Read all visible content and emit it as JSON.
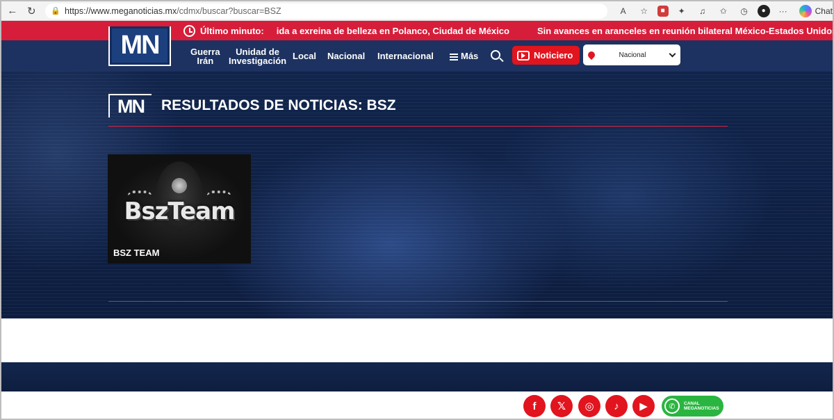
{
  "browser": {
    "url_host": "https://www.meganoticias.mx",
    "url_path": "/cdmx/buscar?buscar=BSZ",
    "chat_label": "Chat"
  },
  "breaking": {
    "label": "Último minuto:",
    "items": [
      "ida a exreina de belleza en Polanco, Ciudad de México",
      "Sin avances en aranceles en reunión bilateral México-Estados Unidos"
    ]
  },
  "header": {
    "logo_text": "MN",
    "nav": [
      {
        "line1": "Guerra",
        "line2": "Irán"
      },
      {
        "line1": "Unidad de",
        "line2": "Investigación"
      },
      {
        "label": "Local"
      },
      {
        "label": "Nacional"
      },
      {
        "label": "Internacional"
      },
      {
        "label": "Más"
      }
    ],
    "noticiero_label": "Noticiero",
    "region_value": "Nacional"
  },
  "results": {
    "badge": "MN",
    "title": "RESULTADOS DE NOTICIAS: BSZ",
    "cards": [
      {
        "title": "BSZ TEAM",
        "image_text": "BszTeam"
      }
    ]
  },
  "footer": {
    "social": [
      "facebook-icon",
      "x-icon",
      "instagram-icon",
      "tiktok-icon",
      "youtube-icon"
    ],
    "whatsapp_line1": "CANAL",
    "whatsapp_line2": "MEGANOTICIAS"
  },
  "colors": {
    "brand_red": "#d61e3a",
    "nav_blue": "#1d3260",
    "whatsapp_green": "#2ab540"
  }
}
